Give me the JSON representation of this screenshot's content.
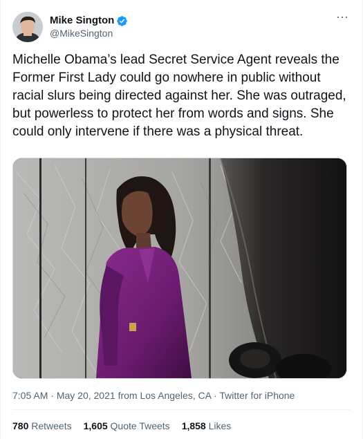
{
  "author": {
    "display_name": "Mike Sington",
    "handle": "@MikeSington",
    "verified": true
  },
  "more_icon": "ellipsis-icon",
  "tweet": {
    "text": "Michelle Obama’s lead Secret Service Agent reveals the Former First Lady could go nowhere in public without racial slurs being directed against her. She was outraged, but powerless to protect her from words and signs. She could only intervene if there was a physical threat.",
    "time": "7:05 AM",
    "date": "May 20, 2021",
    "location": "from Los Angeles, CA",
    "source": "Twitter for iPhone",
    "sep": "·"
  },
  "stats": {
    "retweets_count": "780",
    "retweets_label": "Retweets",
    "quotes_count": "1,605",
    "quotes_label": "Quote Tweets",
    "likes_count": "1,858",
    "likes_label": "Likes"
  },
  "colors": {
    "verified_blue": "#1d9bf0",
    "secondary_text": "#536471",
    "outfit_purple": "#6a1b6e"
  }
}
